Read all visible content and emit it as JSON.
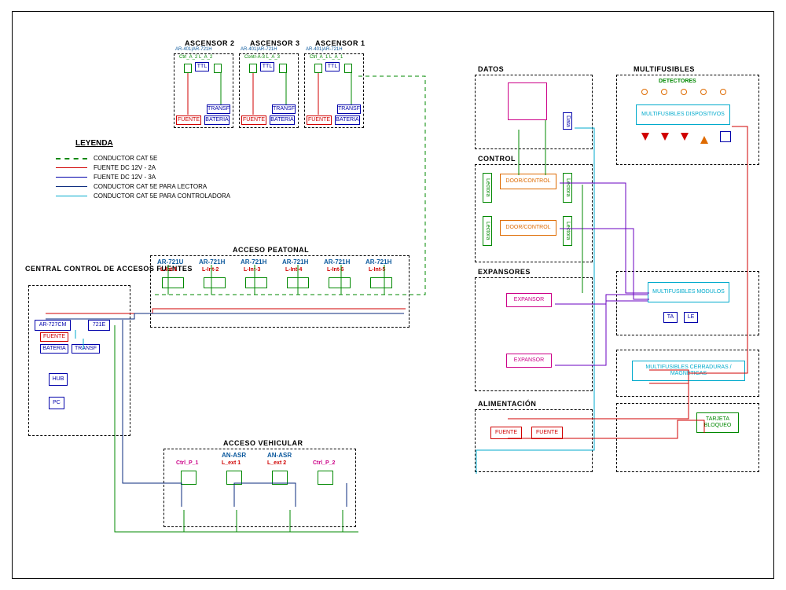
{
  "legend": {
    "title": "LEYENDA",
    "items": [
      {
        "label": "CONDUCTOR CAT 5E",
        "color": "#008800",
        "dash": true
      },
      {
        "label": "FUENTE DC 12V - 2A",
        "color": "#d00000",
        "dash": false
      },
      {
        "label": "FUENTE DC 12V - 3A",
        "color": "#0000aa",
        "dash": false
      },
      {
        "label": "CONDUCTOR CAT 5E PARA LECTORA",
        "color": "#0a2a7d",
        "dash": false
      },
      {
        "label": "CONDUCTOR CAT 5E PARA CONTROLADORA",
        "color": "#00aacc",
        "dash": false
      }
    ]
  },
  "ascensores": {
    "units": [
      {
        "title": "ASCENSOR 2",
        "models": "AR-401|AR-721H",
        "ctrl": "Ctrl_A_2  L_A_2"
      },
      {
        "title": "ASCENSOR 3",
        "models": "AR-401|AR-721H",
        "ctrl": "Contr-A-3 L_A_3"
      },
      {
        "title": "ASCENSOR 1",
        "models": "AR-401|AR-721H",
        "ctrl": "Ctrl_A_1  L_A_1"
      }
    ],
    "boxes": {
      "ttl": "TTL",
      "transf": "TRANSF",
      "fuente": "FUENTE",
      "bateria": "BATERIA"
    }
  },
  "central": {
    "title": "CENTRAL CONTROL DE ACCESOS FUENTES",
    "b727": "AR-727CM",
    "b716": "721E",
    "fuente": "FUENTE",
    "bateria": "BATERIA",
    "transf": "TRANSF",
    "hub": "HUB",
    "pc": "PC"
  },
  "peatonal": {
    "title": "ACCESO PEATONAL",
    "units": [
      {
        "model": "AR-721U",
        "loc": "L-Int-1"
      },
      {
        "model": "AR-721H",
        "loc": "L-Int-2"
      },
      {
        "model": "AR-721H",
        "loc": "L-Int-3"
      },
      {
        "model": "AR-721H",
        "loc": "L-Int-4"
      },
      {
        "model": "AR-721H",
        "loc": "L-Int-6"
      },
      {
        "model": "AR-721H",
        "loc": "L-Int-5"
      }
    ]
  },
  "vehicular": {
    "title": "ACCESO VEHICULAR",
    "units": [
      {
        "model": "",
        "loc": "Ctrl_P_1",
        "cls": "mag"
      },
      {
        "model": "AN-ASR",
        "loc": "L_ext 1",
        "cls": "red"
      },
      {
        "model": "AN-ASR",
        "loc": "L_ext 2",
        "cls": "red"
      },
      {
        "model": "",
        "loc": "Ctrl_P_2",
        "cls": "mag"
      }
    ]
  },
  "right": {
    "datos": "DATOS",
    "control": "CONTROL",
    "doorcontrol": "DOOR/CONTROL",
    "lectora": "Lectora",
    "expansores": "EXPANSORES",
    "expansor": "EXPANSOR",
    "alimentacion": "ALIMENTACIÓN",
    "fuente": "FUENTE",
    "multifusibles": "MULTIFUSIBLES",
    "detectores": "DETECTORES",
    "mf_disp": "MULTIFUSIBLES DISPOSITIVOS",
    "mf_mod": "MULTIFUSIBLES MODULOS",
    "ta": "TA",
    "le": "LE",
    "mf_cerr": "MULTIFUSIBLES CERRADURAS / MAGNETICAS",
    "tarjeta": "TARJETA BLOQUEO",
    "data_lbl": "Data"
  }
}
